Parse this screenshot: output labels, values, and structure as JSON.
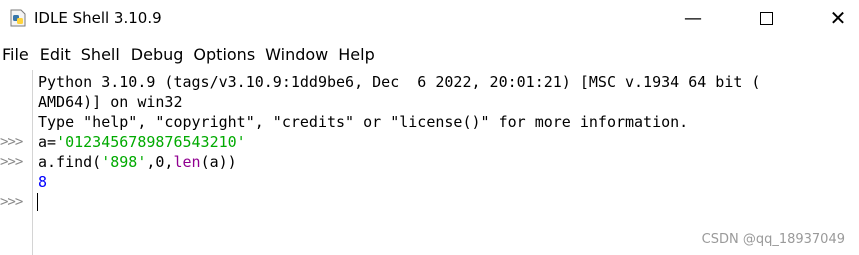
{
  "window": {
    "title": "IDLE Shell 3.10.9",
    "app_icon": "python-feather-icon",
    "minimize_glyph": "—",
    "close_glyph": "✕"
  },
  "menu": [
    "File",
    "Edit",
    "Shell",
    "Debug",
    "Options",
    "Window",
    "Help"
  ],
  "shell": {
    "banner_line1": "Python 3.10.9 (tags/v3.10.9:1dd9be6, Dec  6 2022, 20:01:21) [MSC v.1934 64 bit (",
    "banner_line2": "AMD64)] on win32",
    "banner_line3": "Type \"help\", \"copyright\", \"credits\" or \"license()\" for more information.",
    "prompt": ">>>",
    "cmd1_prefix": "a=",
    "cmd1_string": "'0123456789876543210'",
    "cmd2_prefix": "a.find(",
    "cmd2_string": "'898'",
    "cmd2_mid": ",0,",
    "cmd2_builtin": "len",
    "cmd2_suffix": "(a))",
    "output1": "8"
  },
  "watermark": "CSDN @qq_18937049",
  "colors": {
    "string": "#00aa00",
    "builtin": "#900090",
    "output": "#0000ff",
    "prompt": "#8a8a8a"
  }
}
